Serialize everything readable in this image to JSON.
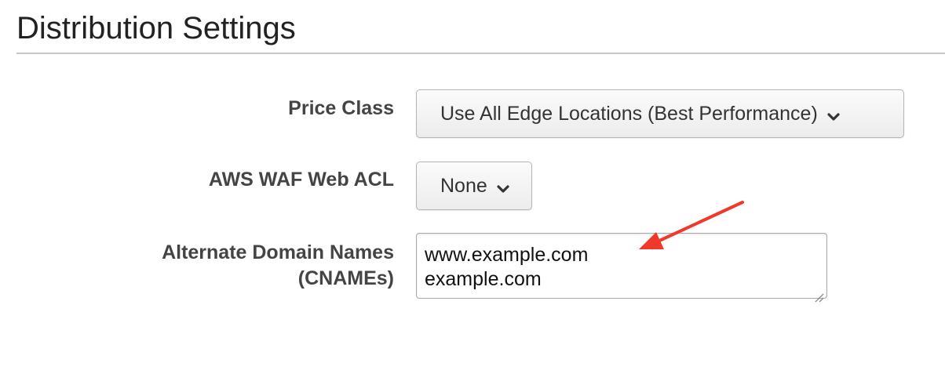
{
  "section": {
    "title": "Distribution Settings"
  },
  "fields": {
    "price_class": {
      "label": "Price Class",
      "selected": "Use All Edge Locations (Best Performance)"
    },
    "waf_acl": {
      "label": "AWS WAF Web ACL",
      "selected": "None"
    },
    "cnames": {
      "label_line1": "Alternate Domain Names",
      "label_line2": "(CNAMEs)",
      "values": [
        "www.example.com",
        "example.com"
      ]
    }
  },
  "icons": {
    "dropdown": "chevron-down-icon",
    "resize": "resize-grip-icon",
    "annotation": "red-arrow"
  },
  "colors": {
    "annotation_arrow": "#f0392b",
    "title_rule": "#c8c8c8"
  }
}
